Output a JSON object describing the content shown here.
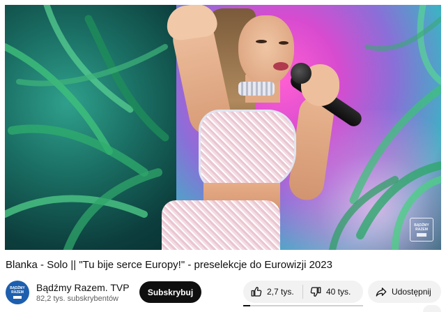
{
  "video": {
    "watermark_text": "BĄDŹMY RAZEM"
  },
  "title": "Blanka - Solo || \"Tu bije serce Europy!\" - preselekcje do Eurowizji 2023",
  "channel": {
    "name": "Bądźmy Razem. TVP",
    "subscribers": "82,2 tys. subskrybentów",
    "avatar_text": "BĄDŹMY RAZEM",
    "subscribe_label": "Subskrybuj"
  },
  "actions": {
    "like_count": "2,7 tys.",
    "dislike_count": "40 tys.",
    "share_label": "Udostępnij",
    "like_ratio": 0.06
  },
  "icons": {
    "like": "thumb-up-icon",
    "dislike": "thumb-down-icon",
    "share": "share-arrow-icon"
  },
  "colors": {
    "subscribe_bg": "#0f0f0f",
    "pill_bg": "#f2f2f2",
    "avatar_bg": "#1d5fae"
  }
}
